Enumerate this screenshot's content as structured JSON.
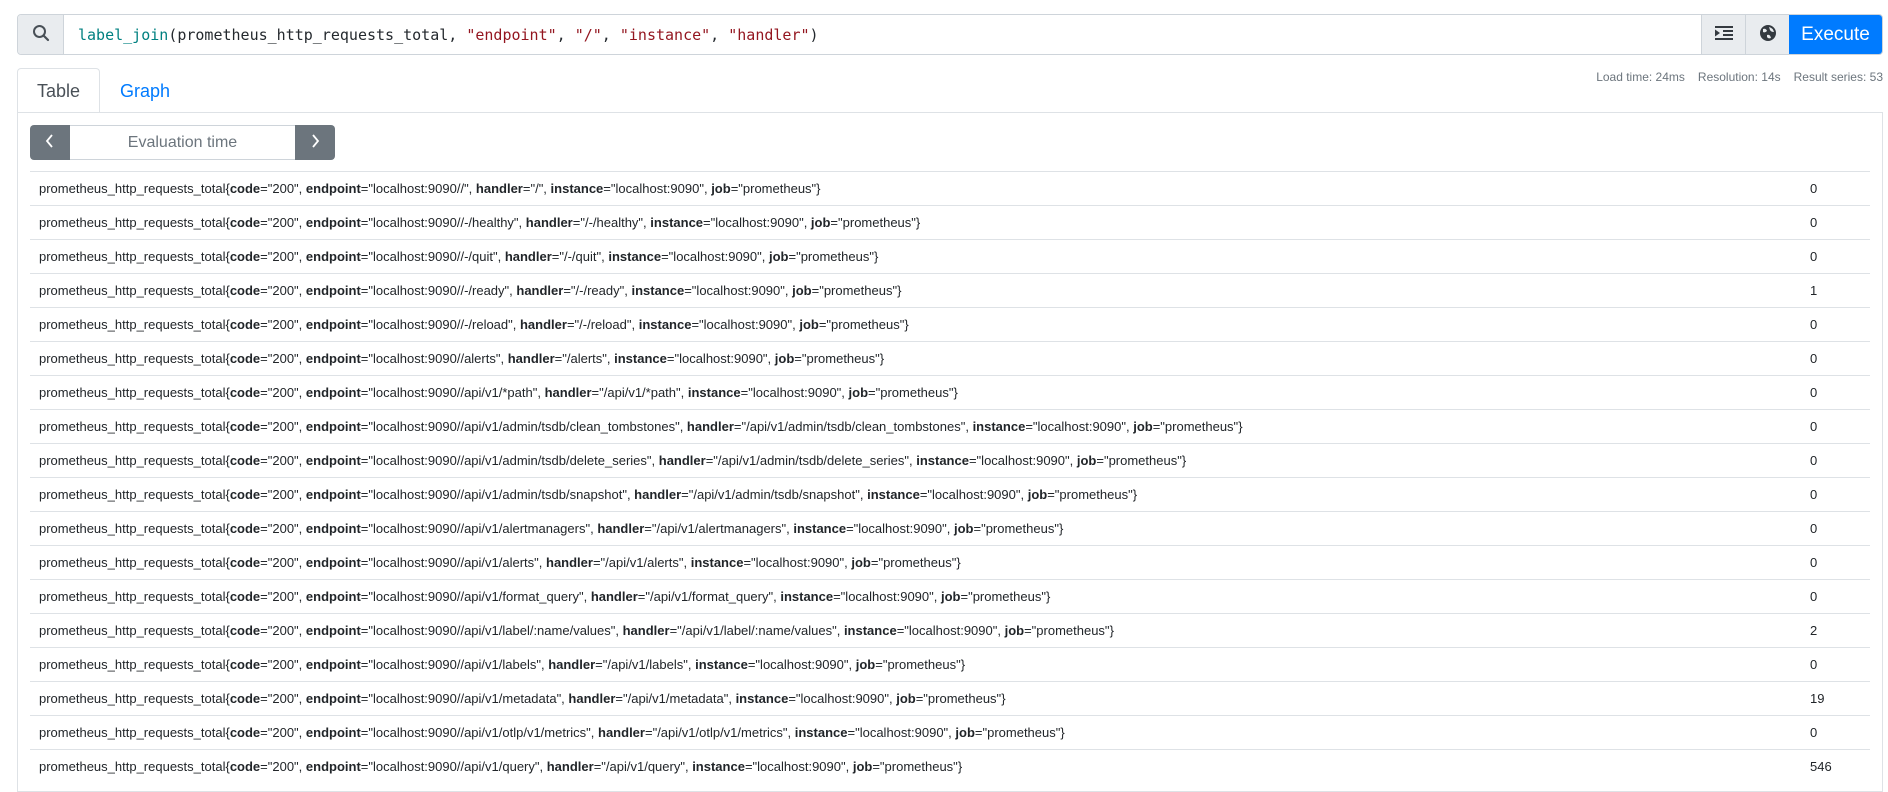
{
  "query": {
    "search_icon": "search-icon",
    "expression_tokens": [
      {
        "text": "label_join",
        "kind": "fn"
      },
      {
        "text": "(prometheus_http_requests_total, ",
        "kind": "plain"
      },
      {
        "text": "\"endpoint\"",
        "kind": "str"
      },
      {
        "text": ", ",
        "kind": "plain"
      },
      {
        "text": "\"/\"",
        "kind": "str"
      },
      {
        "text": ", ",
        "kind": "plain"
      },
      {
        "text": "\"instance\"",
        "kind": "str"
      },
      {
        "text": ", ",
        "kind": "plain"
      },
      {
        "text": "\"handler\"",
        "kind": "str"
      },
      {
        "text": ")",
        "kind": "plain"
      }
    ],
    "format_icon": "format-indent-icon",
    "metrics_explorer_icon": "globe-icon",
    "execute_label": "Execute"
  },
  "tabs": [
    {
      "label": "Table",
      "active": true
    },
    {
      "label": "Graph",
      "active": false
    }
  ],
  "stats": {
    "load_time": "Load time: 24ms",
    "resolution": "Resolution: 14s",
    "result_series": "Result series: 53"
  },
  "evaluation": {
    "placeholder": "Evaluation time",
    "prev_icon": "chevron-left-icon",
    "next_icon": "chevron-right-icon"
  },
  "colors": {
    "accent": "#007bff",
    "string_token": "#93151f",
    "function_token": "#008080",
    "eval_button": "#6c757d"
  },
  "metric_name": "prometheus_http_requests_total",
  "results": [
    {
      "code": "200",
      "endpoint": "localhost:9090//",
      "handler": "/",
      "instance": "localhost:9090",
      "job": "prometheus",
      "value": "0"
    },
    {
      "code": "200",
      "endpoint": "localhost:9090//-/healthy",
      "handler": "/-/healthy",
      "instance": "localhost:9090",
      "job": "prometheus",
      "value": "0"
    },
    {
      "code": "200",
      "endpoint": "localhost:9090//-/quit",
      "handler": "/-/quit",
      "instance": "localhost:9090",
      "job": "prometheus",
      "value": "0"
    },
    {
      "code": "200",
      "endpoint": "localhost:9090//-/ready",
      "handler": "/-/ready",
      "instance": "localhost:9090",
      "job": "prometheus",
      "value": "1"
    },
    {
      "code": "200",
      "endpoint": "localhost:9090//-/reload",
      "handler": "/-/reload",
      "instance": "localhost:9090",
      "job": "prometheus",
      "value": "0"
    },
    {
      "code": "200",
      "endpoint": "localhost:9090//alerts",
      "handler": "/alerts",
      "instance": "localhost:9090",
      "job": "prometheus",
      "value": "0"
    },
    {
      "code": "200",
      "endpoint": "localhost:9090//api/v1/*path",
      "handler": "/api/v1/*path",
      "instance": "localhost:9090",
      "job": "prometheus",
      "value": "0"
    },
    {
      "code": "200",
      "endpoint": "localhost:9090//api/v1/admin/tsdb/clean_tombstones",
      "handler": "/api/v1/admin/tsdb/clean_tombstones",
      "instance": "localhost:9090",
      "job": "prometheus",
      "value": "0"
    },
    {
      "code": "200",
      "endpoint": "localhost:9090//api/v1/admin/tsdb/delete_series",
      "handler": "/api/v1/admin/tsdb/delete_series",
      "instance": "localhost:9090",
      "job": "prometheus",
      "value": "0"
    },
    {
      "code": "200",
      "endpoint": "localhost:9090//api/v1/admin/tsdb/snapshot",
      "handler": "/api/v1/admin/tsdb/snapshot",
      "instance": "localhost:9090",
      "job": "prometheus",
      "value": "0"
    },
    {
      "code": "200",
      "endpoint": "localhost:9090//api/v1/alertmanagers",
      "handler": "/api/v1/alertmanagers",
      "instance": "localhost:9090",
      "job": "prometheus",
      "value": "0"
    },
    {
      "code": "200",
      "endpoint": "localhost:9090//api/v1/alerts",
      "handler": "/api/v1/alerts",
      "instance": "localhost:9090",
      "job": "prometheus",
      "value": "0"
    },
    {
      "code": "200",
      "endpoint": "localhost:9090//api/v1/format_query",
      "handler": "/api/v1/format_query",
      "instance": "localhost:9090",
      "job": "prometheus",
      "value": "0"
    },
    {
      "code": "200",
      "endpoint": "localhost:9090//api/v1/label/:name/values",
      "handler": "/api/v1/label/:name/values",
      "instance": "localhost:9090",
      "job": "prometheus",
      "value": "2"
    },
    {
      "code": "200",
      "endpoint": "localhost:9090//api/v1/labels",
      "handler": "/api/v1/labels",
      "instance": "localhost:9090",
      "job": "prometheus",
      "value": "0"
    },
    {
      "code": "200",
      "endpoint": "localhost:9090//api/v1/metadata",
      "handler": "/api/v1/metadata",
      "instance": "localhost:9090",
      "job": "prometheus",
      "value": "19"
    },
    {
      "code": "200",
      "endpoint": "localhost:9090//api/v1/otlp/v1/metrics",
      "handler": "/api/v1/otlp/v1/metrics",
      "instance": "localhost:9090",
      "job": "prometheus",
      "value": "0"
    },
    {
      "code": "200",
      "endpoint": "localhost:9090//api/v1/query",
      "handler": "/api/v1/query",
      "instance": "localhost:9090",
      "job": "prometheus",
      "value": "546"
    }
  ]
}
